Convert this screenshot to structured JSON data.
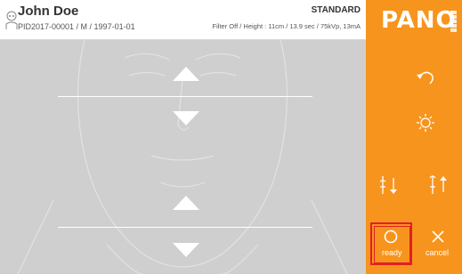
{
  "patient": {
    "name": "John Doe",
    "info": "PID2017-00001 / M / 1997-01-01"
  },
  "exam": {
    "mode": "STANDARD",
    "params": "Filter Off / Height : 11cm / 13.9 sec / 75kVp, 13mA"
  },
  "brand": {
    "logo": "PANO"
  },
  "sidebar": {
    "ready_label": "ready",
    "cancel_label": "cancel"
  },
  "icons": {
    "avatar": "user-icon",
    "reset": "undo-icon",
    "light": "light-icon",
    "chin_down": "chin-rest-down-icon",
    "chin_up": "chin-rest-up-icon",
    "ready": "circle-icon",
    "cancel": "close-icon"
  },
  "colors": {
    "accent": "#f7941d",
    "viewport": "#cfcfcf",
    "highlight": "#e31e24"
  }
}
